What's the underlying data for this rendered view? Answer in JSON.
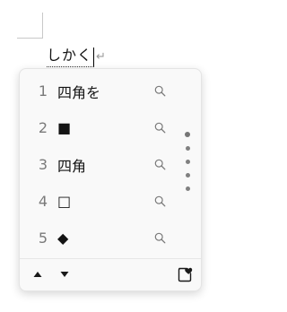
{
  "document": {
    "composition_text": "しかく",
    "return_mark": "↵"
  },
  "candidates": [
    {
      "number": "1",
      "text": "四角を"
    },
    {
      "number": "2",
      "text": "■"
    },
    {
      "number": "3",
      "text": "四角"
    },
    {
      "number": "4",
      "text": "□"
    },
    {
      "number": "5",
      "text": "◆"
    }
  ],
  "icons": {
    "search": "search-icon",
    "prev_page": "triangle-up-icon",
    "next_page": "triangle-down-icon",
    "favorite": "emoji-heart-icon",
    "scroll": "scroll-dots-indicator"
  },
  "colors": {
    "window_bg": "#f9f9f9",
    "number": "#7a7a7a",
    "text": "#141414"
  }
}
